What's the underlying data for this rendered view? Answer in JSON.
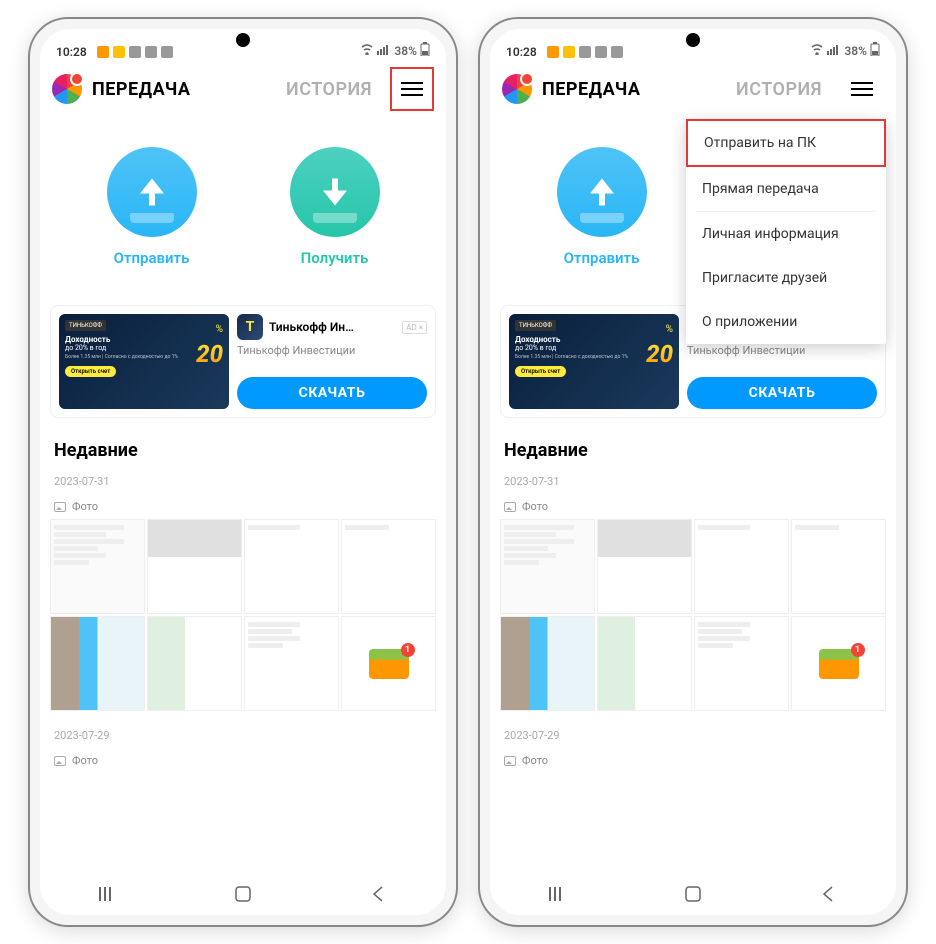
{
  "statusbar": {
    "time": "10:28",
    "battery": "38%"
  },
  "topnav": {
    "tab_active": "ПЕРЕДАЧА",
    "tab_inactive": "ИСТОРИЯ"
  },
  "actions": {
    "send": "Отправить",
    "receive": "Получить"
  },
  "ad": {
    "brand": "ТИНЬКОФФ",
    "headline1": "Доходность",
    "headline2": "до 20% в год",
    "fineprint": "Более 1.35 млн | Согласно с доходностью до 1%",
    "imgbtn": "Открыть счет",
    "bignum": "20",
    "pct": "%",
    "title": "Тинькофф Ин…",
    "badge": "AD ×",
    "subtitle": "Тинькофф Инвестиции",
    "download": "СКАЧАТЬ"
  },
  "recent": {
    "title": "Недавние"
  },
  "dates": [
    "2023-07-31",
    "2023-07-29"
  ],
  "category": "Фото",
  "chest_badge": "1",
  "dropdown": [
    "Отправить на ПК",
    "Прямая передача",
    "Личная информация",
    "Пригласите друзей",
    "О приложении"
  ]
}
